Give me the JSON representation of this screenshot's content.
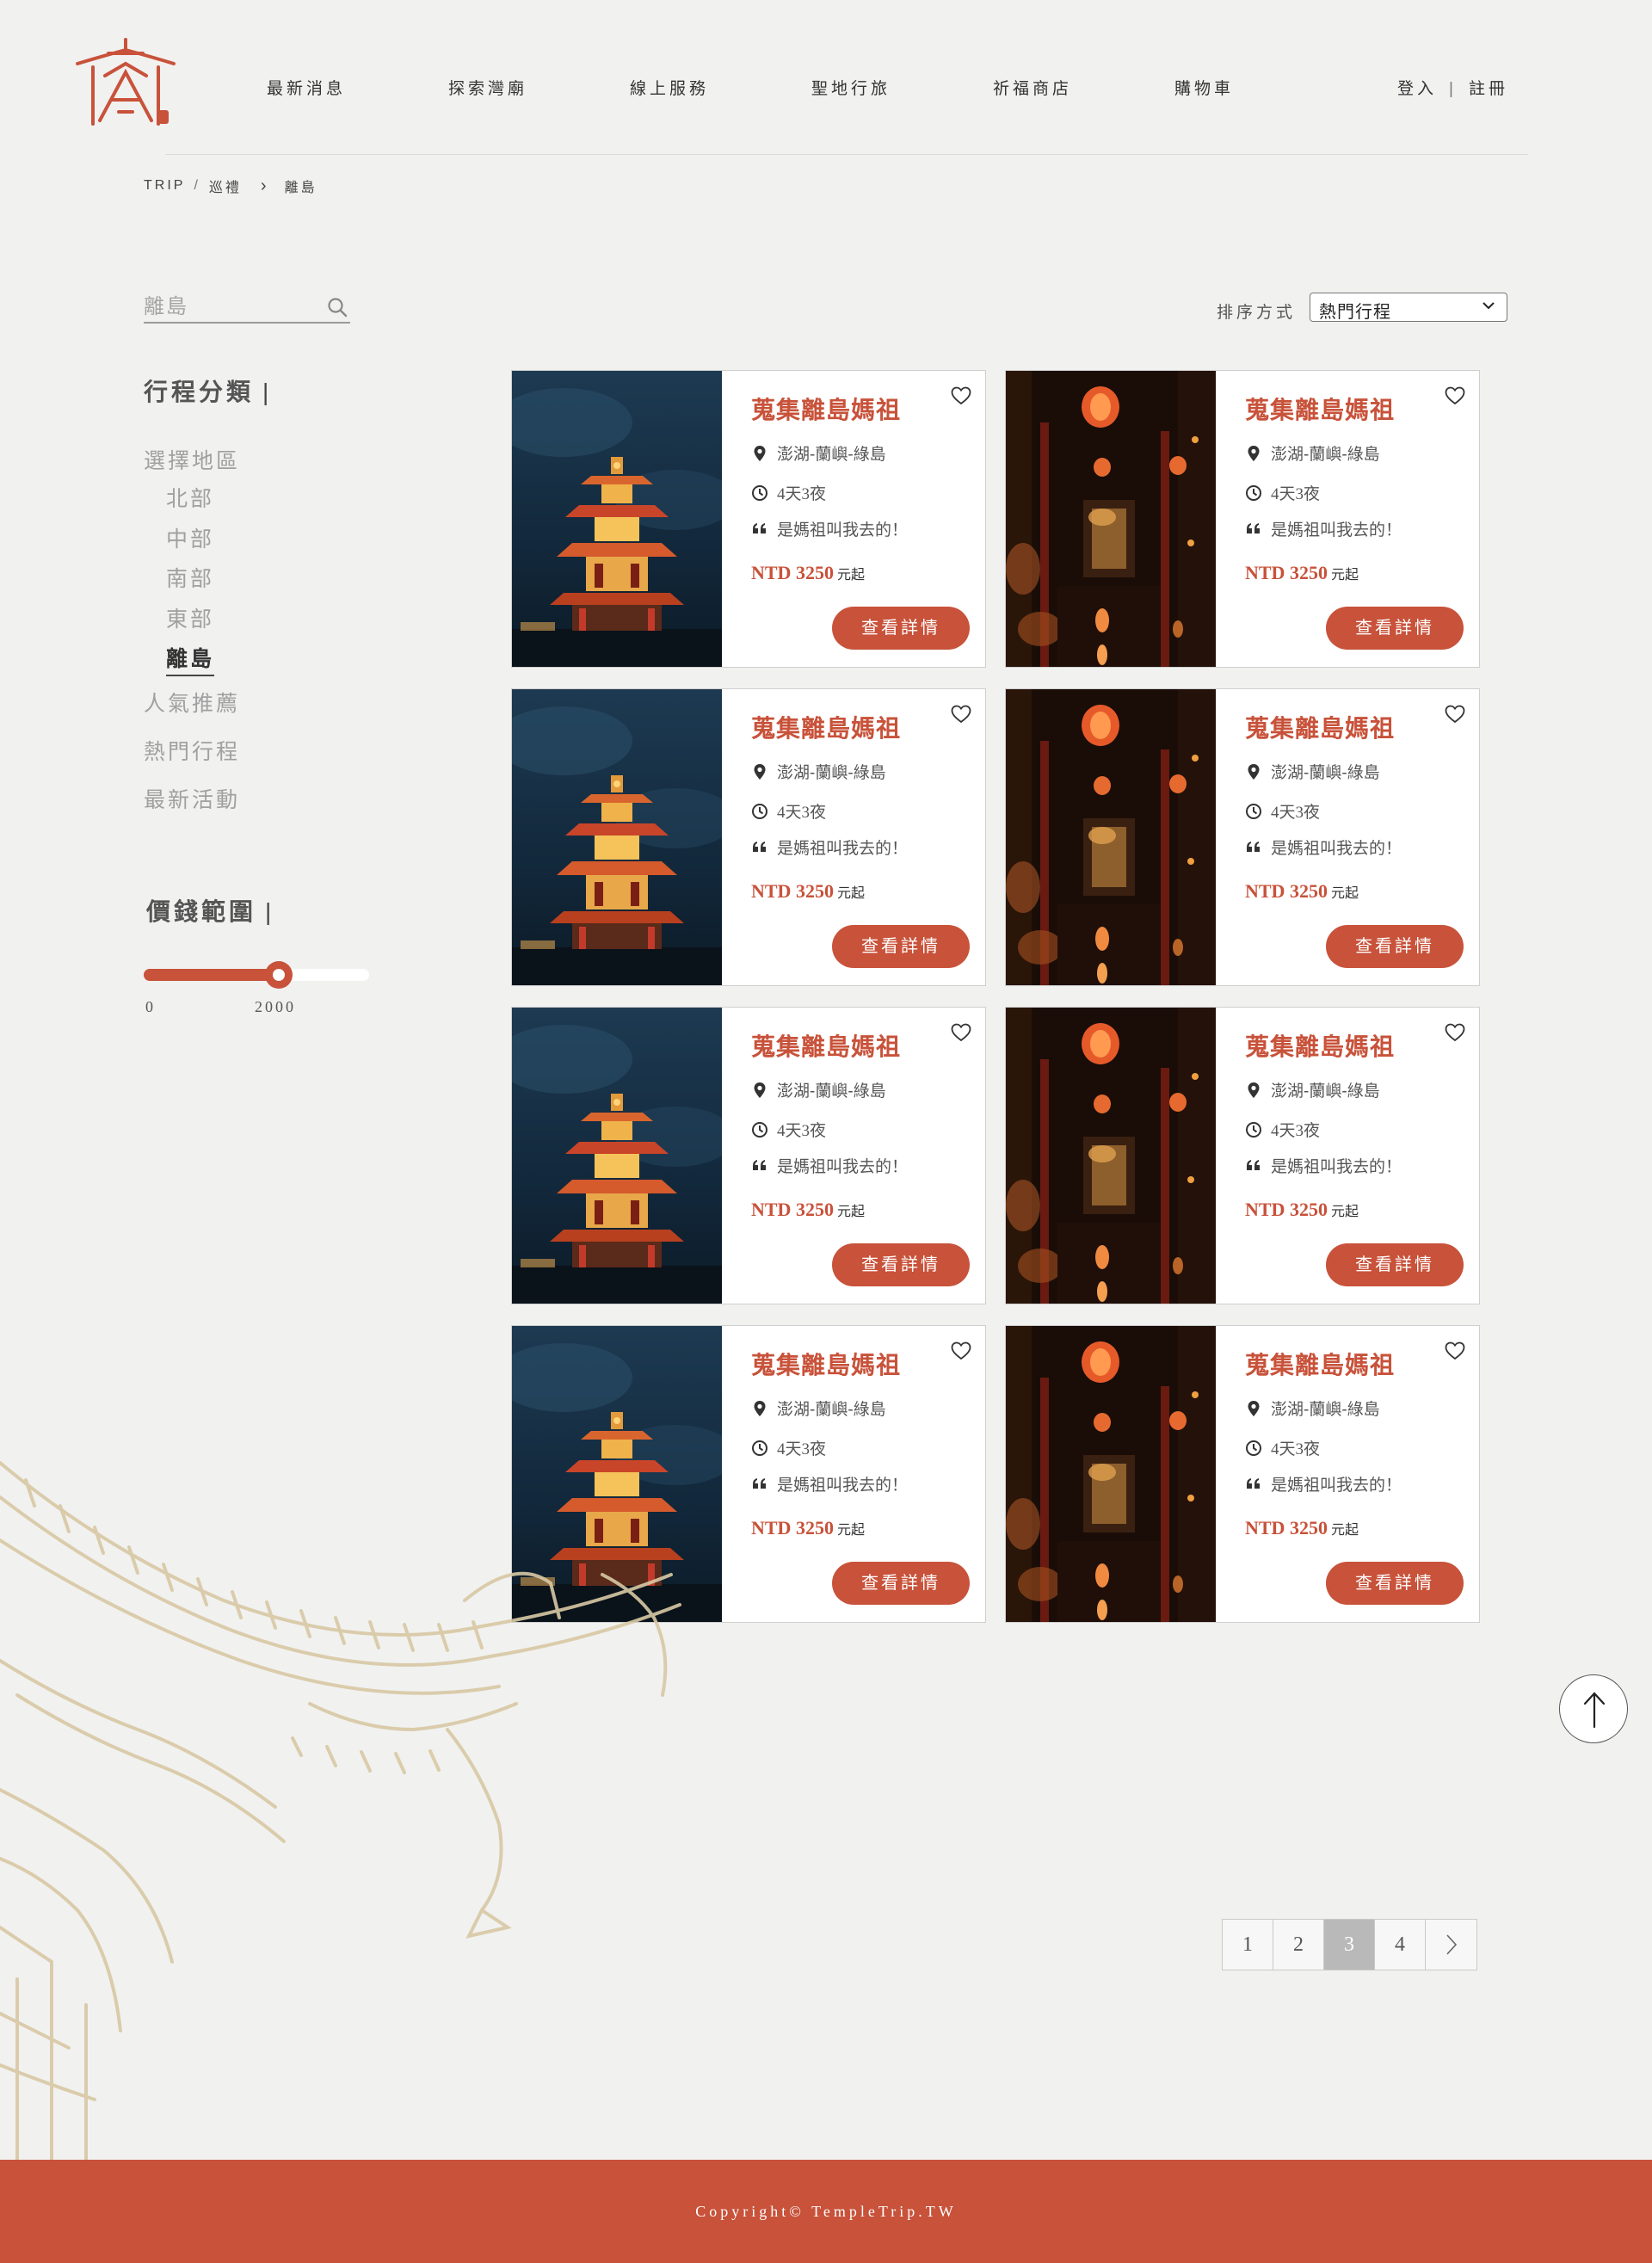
{
  "colors": {
    "accent": "#c8523a",
    "background": "#f1f1f0",
    "footer": "#c8523a",
    "sketch": "#d8c9a4"
  },
  "nav": {
    "items": [
      "最新消息",
      "探索灣廟",
      "線上服務",
      "聖地行旅",
      "祈福商店",
      "購物車"
    ],
    "login": "登入",
    "divider": "|",
    "register": "註冊"
  },
  "breadcrumb": {
    "root": "TRIP",
    "sep": "/",
    "parent": "巡禮",
    "current": "離島"
  },
  "search": {
    "placeholder": "離島",
    "icon": "search-icon"
  },
  "sidebar": {
    "category_title": "行程分類",
    "title_bar": "|",
    "region_label": "選擇地區",
    "regions": [
      "北部",
      "中部",
      "南部",
      "東部",
      "離島"
    ],
    "active_region": "離島",
    "extra_items": [
      "人氣推薦",
      "熱門行程",
      "最新活動"
    ],
    "price_title": "價錢範圍",
    "price_min_label": "0",
    "price_max_label": "2000",
    "price_fraction": 0.6
  },
  "sort": {
    "label": "排序方式",
    "selected": "熱門行程"
  },
  "cards": [
    {
      "title": "蒐集離島媽祖",
      "location": "澎湖-蘭嶼-綠島",
      "duration": "4天3夜",
      "quote": "是媽祖叫我去的！",
      "price": "NTD 3250",
      "price_unit": "元起",
      "button": "查看詳情",
      "image": "temple-tower-night"
    },
    {
      "title": "蒐集離島媽祖",
      "location": "澎湖-蘭嶼-綠島",
      "duration": "4天3夜",
      "quote": "是媽祖叫我去的！",
      "price": "NTD 3250",
      "price_unit": "元起",
      "button": "查看詳情",
      "image": "temple-lantern-hall"
    },
    {
      "title": "蒐集離島媽祖",
      "location": "澎湖-蘭嶼-綠島",
      "duration": "4天3夜",
      "quote": "是媽祖叫我去的！",
      "price": "NTD 3250",
      "price_unit": "元起",
      "button": "查看詳情",
      "image": "temple-tower-night"
    },
    {
      "title": "蒐集離島媽祖",
      "location": "澎湖-蘭嶼-綠島",
      "duration": "4天3夜",
      "quote": "是媽祖叫我去的！",
      "price": "NTD 3250",
      "price_unit": "元起",
      "button": "查看詳情",
      "image": "temple-lantern-hall"
    },
    {
      "title": "蒐集離島媽祖",
      "location": "澎湖-蘭嶼-綠島",
      "duration": "4天3夜",
      "quote": "是媽祖叫我去的！",
      "price": "NTD 3250",
      "price_unit": "元起",
      "button": "查看詳情",
      "image": "temple-tower-night"
    },
    {
      "title": "蒐集離島媽祖",
      "location": "澎湖-蘭嶼-綠島",
      "duration": "4天3夜",
      "quote": "是媽祖叫我去的！",
      "price": "NTD 3250",
      "price_unit": "元起",
      "button": "查看詳情",
      "image": "temple-lantern-hall"
    },
    {
      "title": "蒐集離島媽祖",
      "location": "澎湖-蘭嶼-綠島",
      "duration": "4天3夜",
      "quote": "是媽祖叫我去的！",
      "price": "NTD 3250",
      "price_unit": "元起",
      "button": "查看詳情",
      "image": "temple-tower-night"
    },
    {
      "title": "蒐集離島媽祖",
      "location": "澎湖-蘭嶼-綠島",
      "duration": "4天3夜",
      "quote": "是媽祖叫我去的！",
      "price": "NTD 3250",
      "price_unit": "元起",
      "button": "查看詳情",
      "image": "temple-lantern-hall"
    }
  ],
  "pagination": {
    "pages": [
      "1",
      "2",
      "3",
      "4"
    ],
    "current": "3",
    "next_icon": "chevron-right-icon"
  },
  "back_to_top_icon": "arrow-up-icon",
  "footer": {
    "copyright": "Copyright© TempleTrip.TW"
  }
}
